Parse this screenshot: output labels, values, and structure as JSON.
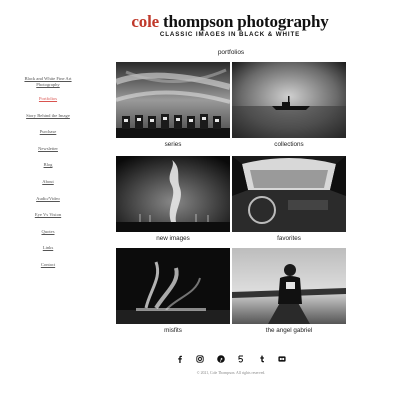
{
  "header": {
    "title_first": "cole",
    "title_rest": "thompson photography",
    "tagline": "CLASSIC IMAGES IN BLACK & WHITE",
    "accent_color": "#c0392b"
  },
  "section": {
    "heading": "portfolios"
  },
  "sidebar": {
    "items": [
      {
        "label": "Black and White Fine Art Photography",
        "active": false
      },
      {
        "label": "Portfolios",
        "active": true
      },
      {
        "label": "Story Behind the Image",
        "active": false
      },
      {
        "label": "Purchase",
        "active": false
      },
      {
        "label": "Newsletter",
        "active": false
      },
      {
        "label": "Blog",
        "active": false
      },
      {
        "label": "About",
        "active": false
      },
      {
        "label": "Audio/Video",
        "active": false
      },
      {
        "label": "Eye Vs Vision",
        "active": false
      },
      {
        "label": "Quotes",
        "active": false
      },
      {
        "label": "Links",
        "active": false
      },
      {
        "label": "Contact",
        "active": false
      }
    ]
  },
  "portfolios": [
    {
      "caption": "series"
    },
    {
      "caption": "collections"
    },
    {
      "caption": "new images"
    },
    {
      "caption": "favorites"
    },
    {
      "caption": "misfits"
    },
    {
      "caption": "the angel gabriel"
    }
  ],
  "social": [
    "facebook-icon",
    "instagram-icon",
    "pinterest-icon",
    "500px-icon",
    "tumblr-icon",
    "flickr-icon"
  ],
  "footer": {
    "copyright": "© 2021, Cole Thompson. All rights reserved."
  }
}
